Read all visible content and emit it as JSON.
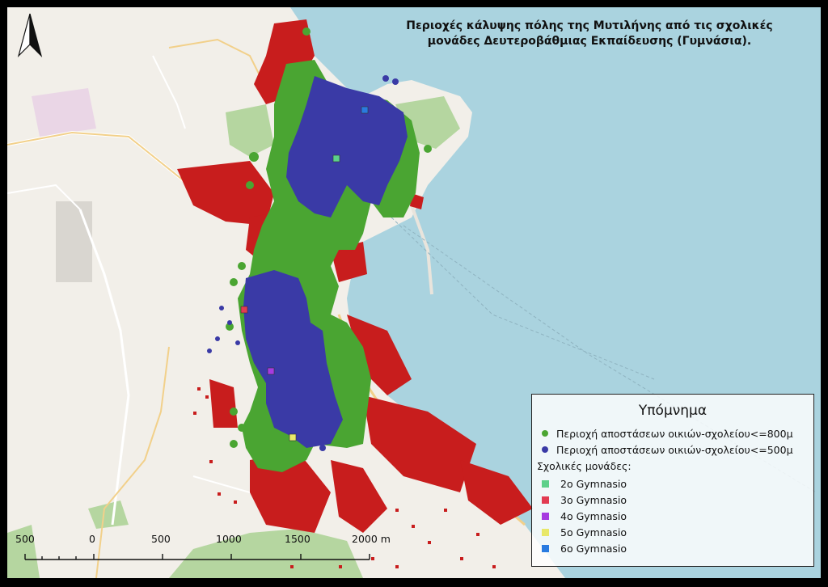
{
  "title": {
    "line1": "Περιοχές κάλυψης πόλης της Μυτιλήνης από τις σχολικές",
    "line2": "μονάδες Δευτεροβάθμιας Εκπαίδευσης (Γυμνάσια)."
  },
  "legend": {
    "title": "Υπόμνημα",
    "coverage": [
      {
        "label": "Περιοχή αποστάσεων οικιών-σχολείου<=800μ",
        "color": "#4aa532"
      },
      {
        "label": "Περιοχή αποστάσεων οικιών-σχολείου<=500μ",
        "color": "#3a3aa6"
      }
    ],
    "schools_title": "Σχολικές μονάδες:",
    "schools": [
      {
        "label": "2o Gymnasio",
        "color": "#5cd08a"
      },
      {
        "label": "3o Gymnasio",
        "color": "#e23b52"
      },
      {
        "label": "4o Gymnasio",
        "color": "#a63be0"
      },
      {
        "label": "5o Gymnasio",
        "color": "#e8e86a"
      },
      {
        "label": "6o Gymnasio",
        "color": "#2a7be0"
      }
    ]
  },
  "scale_bar": {
    "labels": [
      "500",
      "0",
      "500",
      "1000",
      "1500",
      "2000 m"
    ]
  },
  "map_colors": {
    "sea": "#aad3df",
    "land": "#f2efe9",
    "buildings": "#c81d1d",
    "green_areas": "#b5d6a0"
  },
  "icons": {
    "north_arrow": "north-arrow-icon"
  }
}
